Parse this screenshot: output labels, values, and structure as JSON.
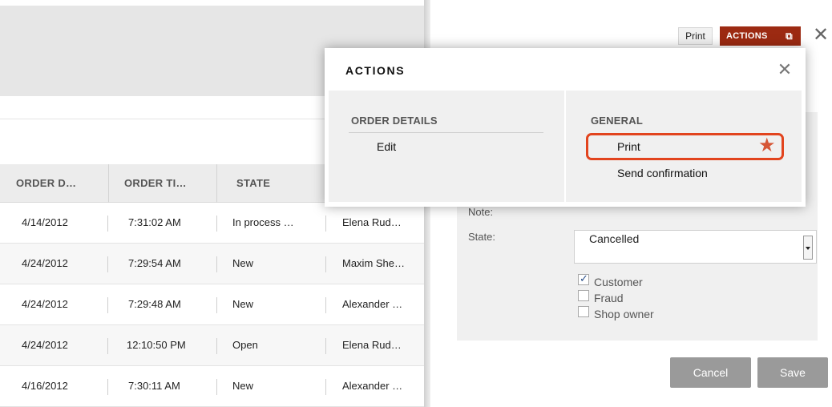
{
  "grid": {
    "columns": [
      "ORDER D…",
      "ORDER TI…",
      "STATE"
    ],
    "rows": [
      {
        "date": "4/14/2012",
        "time": "7:31:02 AM",
        "state": "In process …",
        "customer": "Elena Rud…"
      },
      {
        "date": "4/24/2012",
        "time": "7:29:54 AM",
        "state": "New",
        "customer": "Maxim She…"
      },
      {
        "date": "4/24/2012",
        "time": "7:29:48 AM",
        "state": "New",
        "customer": "Alexander …"
      },
      {
        "date": "4/24/2012",
        "time": "12:10:50 PM",
        "state": "Open",
        "customer": "Elena Rud…"
      },
      {
        "date": "4/16/2012",
        "time": "7:30:11 AM",
        "state": "New",
        "customer": "Alexander …"
      }
    ]
  },
  "toolbar": {
    "print_label": "Print",
    "actions_label": "ACTIONS",
    "actions_icon": "external-window-icon",
    "close_icon": "close-icon"
  },
  "popup": {
    "title": "ACTIONS",
    "sections": [
      {
        "heading": "ORDER DETAILS",
        "items": [
          "Edit"
        ]
      },
      {
        "heading": "GENERAL",
        "items": [
          "Print",
          "Send confirmation"
        ]
      }
    ],
    "favorite_icon": "star-icon",
    "highlight_color": "#e2441e"
  },
  "form": {
    "note_label": "Note:",
    "state_label": "State:",
    "state_value": "Cancelled",
    "checkboxes": [
      {
        "label": "Customer",
        "checked": true
      },
      {
        "label": "Fraud",
        "checked": false
      },
      {
        "label": "Shop owner",
        "checked": false
      }
    ],
    "cancel_label": "Cancel",
    "save_label": "Save"
  },
  "colors": {
    "accent": "#9c2a12",
    "button_gray": "#9a9a9a"
  }
}
